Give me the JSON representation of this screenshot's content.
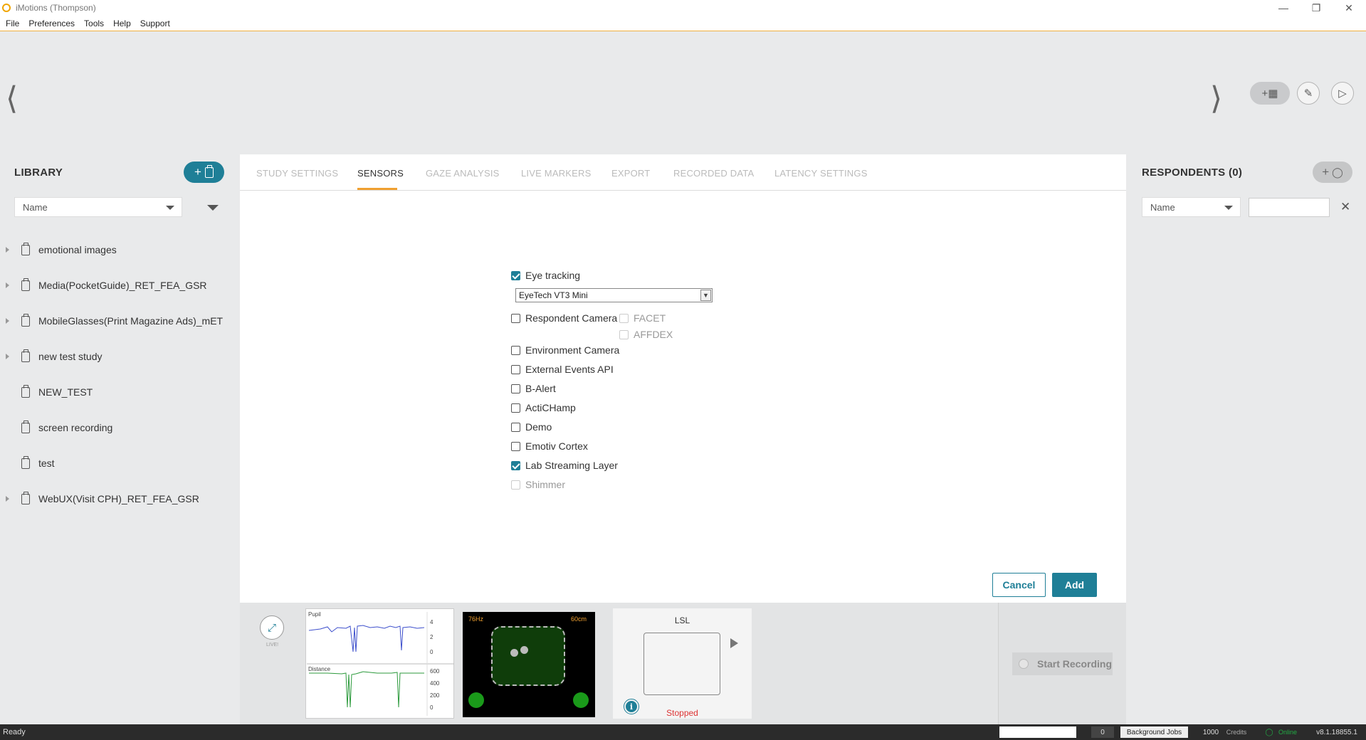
{
  "window": {
    "title": "iMotions (Thompson)",
    "minimize_icon": "minimize-icon",
    "restore_icon": "restore-icon",
    "close_icon": "close-icon"
  },
  "menu": [
    "File",
    "Preferences",
    "Tools",
    "Help",
    "Support"
  ],
  "toolbar": {
    "prev_icon": "chevron-left-icon",
    "next_icon": "chevron-right-icon",
    "add_stimulus_icon": "add-film-icon",
    "edit_icon": "pencil-icon",
    "play_icon": "play-icon"
  },
  "library": {
    "title": "LIBRARY",
    "sort_value": "Name",
    "items": [
      {
        "label": "emotional images",
        "expandable": true
      },
      {
        "label": "Media(PocketGuide)_RET_FEA_GSR",
        "expandable": true
      },
      {
        "label": "MobileGlasses(Print Magazine Ads)_mET",
        "expandable": true
      },
      {
        "label": "new test study",
        "expandable": true
      },
      {
        "label": "NEW_TEST",
        "expandable": false
      },
      {
        "label": "screen recording",
        "expandable": false
      },
      {
        "label": "test",
        "expandable": false
      },
      {
        "label": "WebUX(Visit CPH)_RET_FEA_GSR",
        "expandable": true
      }
    ]
  },
  "tabs": [
    {
      "label": "STUDY SETTINGS",
      "active": false
    },
    {
      "label": "SENSORS",
      "active": true
    },
    {
      "label": "GAZE ANALYSIS",
      "active": false
    },
    {
      "label": "LIVE MARKERS",
      "active": false
    },
    {
      "label": "EXPORT",
      "active": false
    },
    {
      "label": "RECORDED DATA",
      "active": false
    },
    {
      "label": "LATENCY SETTINGS",
      "active": false
    }
  ],
  "sensors": {
    "eye_tracking": {
      "label": "Eye tracking",
      "checked": true
    },
    "eye_tracker_value": "EyeTech VT3 Mini",
    "respondent_camera": {
      "label": "Respondent Camera",
      "checked": false
    },
    "facet": {
      "label": "FACET",
      "checked": false
    },
    "affdex": {
      "label": "AFFDEX",
      "checked": false
    },
    "environment_camera": {
      "label": "Environment Camera",
      "checked": false
    },
    "external_events_api": {
      "label": "External Events API",
      "checked": false
    },
    "b_alert": {
      "label": "B-Alert",
      "checked": false
    },
    "actichamp": {
      "label": "ActiCHamp",
      "checked": false
    },
    "demo": {
      "label": "Demo",
      "checked": false
    },
    "emotiv_cortex": {
      "label": "Emotiv Cortex",
      "checked": false
    },
    "lab_streaming_layer": {
      "label": "Lab Streaming Layer",
      "checked": true
    },
    "shimmer": {
      "label": "Shimmer",
      "checked": false
    }
  },
  "actions": {
    "cancel": "Cancel",
    "add": "Add"
  },
  "live": {
    "label": "LIVE!",
    "pupil_label": "Pupil",
    "pupil_ticks": [
      "4",
      "2",
      "0"
    ],
    "distance_label": "Distance",
    "distance_ticks": [
      "600",
      "400",
      "200",
      "0"
    ],
    "eye_rate": "76Hz",
    "eye_distance": "60cm",
    "lsl_title": "LSL",
    "lsl_status": "Stopped",
    "start_recording": "Start Recording"
  },
  "respondents": {
    "title": "RESPONDENTS (0)",
    "sort_value": "Name",
    "search_value": ""
  },
  "status": {
    "ready": "Ready",
    "jobs_count": "0",
    "background_jobs": "Background Jobs",
    "credits_value": "1000",
    "credits_label": "Credits",
    "online": "Online",
    "version": "v8.1.18855.1"
  },
  "colors": {
    "accent": "#1f7f97",
    "tab_underline": "#f0a030",
    "stopped": "#dd3333",
    "online": "#22aa44"
  }
}
